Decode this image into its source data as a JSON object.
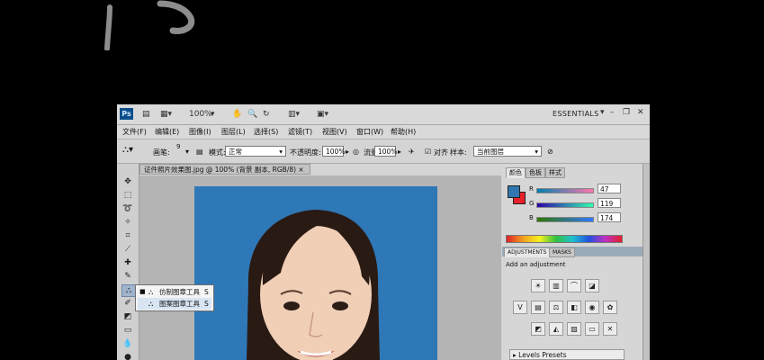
{
  "toolbar": {
    "zoom": "100%",
    "workspace": "ESSENTIALS"
  },
  "menu": [
    "文件(F)",
    "编辑(E)",
    "图像(I)",
    "图层(L)",
    "选择(S)",
    "滤镜(T)",
    "视图(V)",
    "窗口(W)",
    "帮助(H)"
  ],
  "options": {
    "brush_label": "画笔:",
    "brush_size": "9",
    "mode_label": "模式:",
    "mode_value": "正常",
    "opacity_label": "不透明度:",
    "opacity_value": "100%",
    "flow_label": "流量:",
    "flow_value": "100%",
    "align_label": "对齐",
    "sample_label": "样本:",
    "sample_value": "当前图层"
  },
  "document": {
    "tab_title": "证件照片效果图.jpg @ 100% (背景 副本, RGB/8) ×"
  },
  "tool_popup": {
    "items": [
      {
        "label": "仿制图章工具",
        "shortcut": "S"
      },
      {
        "label": "图案图章工具",
        "shortcut": "S"
      }
    ]
  },
  "color_panel": {
    "tabs": [
      "颜色",
      "色板",
      "样式"
    ],
    "channels": [
      {
        "name": "R",
        "value": "47"
      },
      {
        "name": "G",
        "value": "119"
      },
      {
        "name": "B",
        "value": "174"
      }
    ],
    "fg_color": "#2f77ae",
    "bg_color": "#e8202a"
  },
  "adjustments_panel": {
    "tabs": [
      "ADJUSTMENTS",
      "MASKS"
    ],
    "title": "Add an adjustment",
    "preset": "Levels Presets"
  },
  "colors": {
    "canvas_bg": "#2f78b7",
    "app_chrome": "#d4d4d4"
  }
}
